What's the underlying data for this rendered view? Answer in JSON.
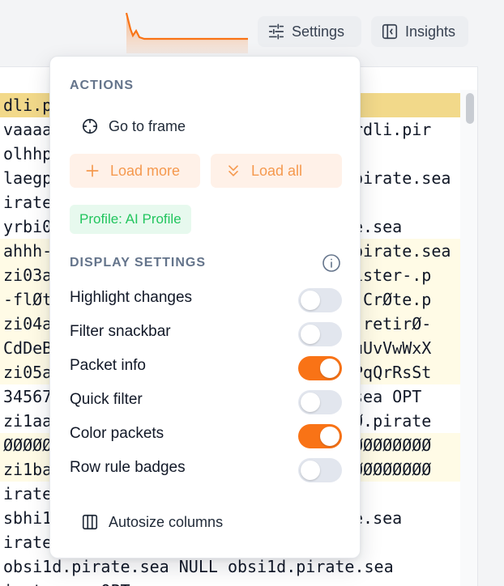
{
  "toolbar": {
    "settings_label": "Settings",
    "insights_label": "Insights",
    "sparkline_color": "#f97316"
  },
  "data_rows": [
    {
      "left": "dli.pi",
      "right": "",
      "highlight": "strong"
    },
    {
      "left": "vaaaa",
      "right": "rdli.pir",
      "highlight": ""
    },
    {
      "left": "olhhpz",
      "right": "",
      "highlight": ""
    },
    {
      "left": "laegp",
      "right": "pirate.sea",
      "highlight": ""
    },
    {
      "left": "irate.",
      "right": "",
      "highlight": ""
    },
    {
      "left": "yrbi0",
      "right": "e.sea",
      "highlight": ""
    },
    {
      "left": "ahhh-",
      "right": "pirate.sea",
      "highlight": "light"
    },
    {
      "left": "zi03a",
      "right": "ister-.p",
      "highlight": "light"
    },
    {
      "left": "-flØt",
      "right": "-CrØte.p",
      "highlight": "light"
    },
    {
      "left": "zi04a",
      "right": "-retirØ-",
      "highlight": "light"
    },
    {
      "left": "CdDeB",
      "right": "uUvVwWxX",
      "highlight": "light"
    },
    {
      "left": "zi05a",
      "right": "PqQrRsSt",
      "highlight": "light"
    },
    {
      "left": "34567",
      "right": "sea OPT",
      "highlight": ""
    },
    {
      "left": "zi1aa",
      "right": "Ø.pirate",
      "highlight": ""
    },
    {
      "left": "ØØØØØ",
      "right": "ØØØØØØØØ",
      "highlight": "light"
    },
    {
      "left": "zi1ba",
      "right": "ØØØØØØØØ",
      "highlight": "light"
    },
    {
      "left": "irate.",
      "right": "",
      "highlight": ""
    },
    {
      "left": "sbhi1",
      "right": "e.sea",
      "highlight": ""
    },
    {
      "left": "irate.",
      "right": "",
      "highlight": ""
    },
    {
      "left": "obsi1d.pirate.sea NULL obsi1d.pirate.sea",
      "right": "",
      "highlight": ""
    },
    {
      "left": "irate.sea OPT",
      "right": "",
      "highlight": ""
    }
  ],
  "popover": {
    "actions_header": "ACTIONS",
    "go_to_frame_label": "Go to frame",
    "load_more_label": "Load more",
    "load_all_label": "Load all",
    "profile_badge": "Profile: AI Profile",
    "display_settings_header": "DISPLAY SETTINGS",
    "settings": [
      {
        "label": "Highlight changes",
        "on": false
      },
      {
        "label": "Filter snackbar",
        "on": false
      },
      {
        "label": "Packet info",
        "on": true
      },
      {
        "label": "Quick filter",
        "on": false
      },
      {
        "label": "Color packets",
        "on": true
      },
      {
        "label": "Row rule badges",
        "on": false
      }
    ],
    "autosize_label": "Autosize columns"
  },
  "colors": {
    "accent_orange": "#f97316",
    "load_button_text": "#f5994e",
    "profile_green": "#22c55e",
    "row_highlight_strong": "#f2d98a",
    "row_highlight_light": "#fffbe6"
  }
}
